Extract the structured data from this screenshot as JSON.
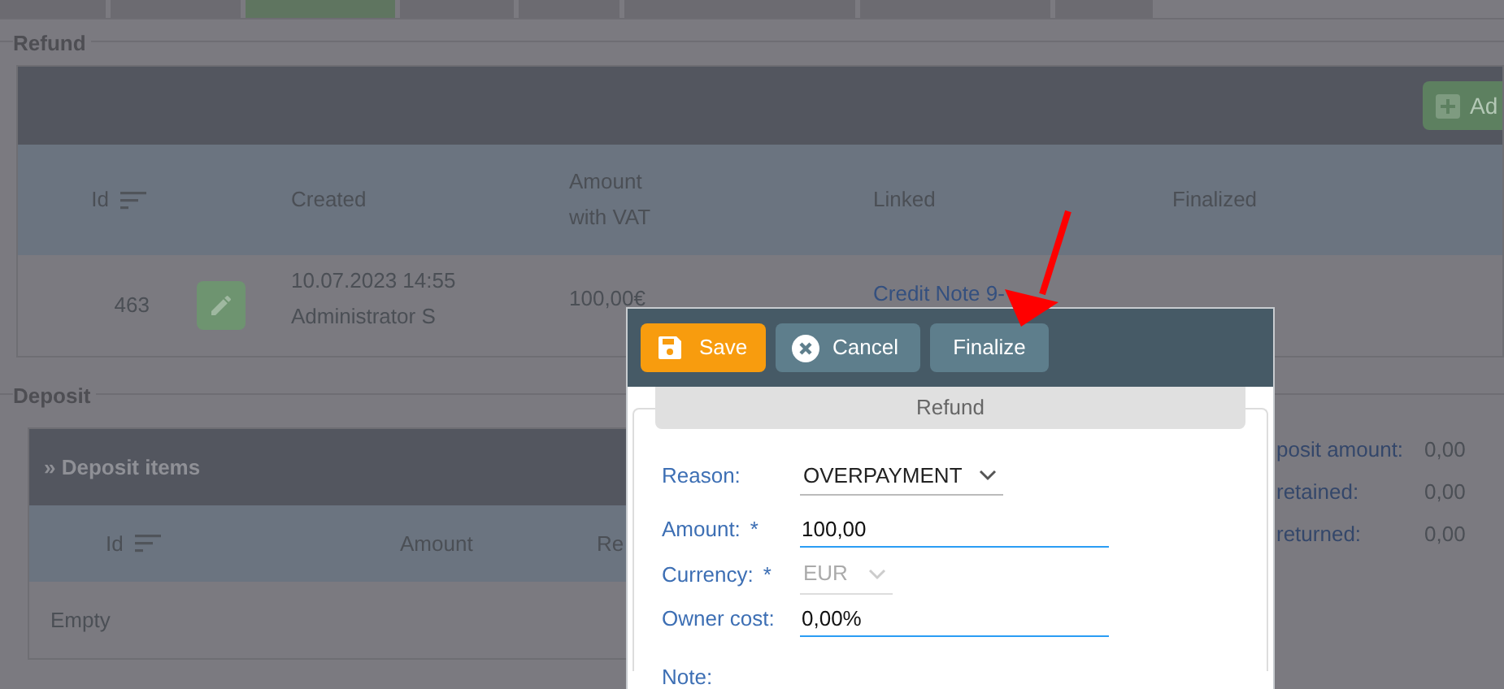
{
  "tabs": [
    {
      "selected": false
    },
    {
      "selected": false
    },
    {
      "selected": true
    },
    {
      "selected": false
    },
    {
      "selected": false
    },
    {
      "selected": false
    },
    {
      "selected": false
    },
    {
      "selected": false
    }
  ],
  "refund": {
    "legend": "Refund",
    "add_button": "Ad",
    "columns": [
      {
        "label": "Id",
        "sortable": true
      },
      {
        "label": "Created"
      },
      {
        "label": "Amount\nwith VAT"
      },
      {
        "label": "Linked"
      },
      {
        "label": "Finalized"
      }
    ],
    "rows": [
      {
        "id": "463",
        "created": "10.07.2023 14:55",
        "author": "Administrator S",
        "amount": "100,00€",
        "linked": "Credit Note 9-"
      }
    ]
  },
  "deposit": {
    "legend": "Deposit",
    "panel_title": "» Deposit items",
    "columns": [
      {
        "label": "Id",
        "sortable": true
      },
      {
        "label": "Amount"
      },
      {
        "label": "Re"
      }
    ],
    "empty_text": "Empty",
    "summary": [
      {
        "label": "posit amount:",
        "value": "0,00"
      },
      {
        "label": "retained:",
        "value": "0,00"
      },
      {
        "label": "returned:",
        "value": "0,00"
      }
    ]
  },
  "dialog": {
    "buttons": [
      {
        "label": "Save",
        "kind": "save"
      },
      {
        "label": "Cancel",
        "kind": "cancel"
      },
      {
        "label": "Finalize",
        "kind": "plain"
      }
    ],
    "tab": "Refund",
    "fields": [
      {
        "label": "Reason:",
        "kind": "select",
        "value": "OVERPAYMENT",
        "disabled": false
      },
      {
        "label": "Amount:",
        "marker": "*",
        "kind": "input",
        "value": "100,00"
      },
      {
        "label": "Currency:",
        "marker": "*",
        "kind": "select",
        "value": "EUR",
        "disabled": true
      },
      {
        "label": "Owner cost:",
        "kind": "input",
        "value": "0,00%"
      }
    ],
    "note_label": "Note:"
  }
}
